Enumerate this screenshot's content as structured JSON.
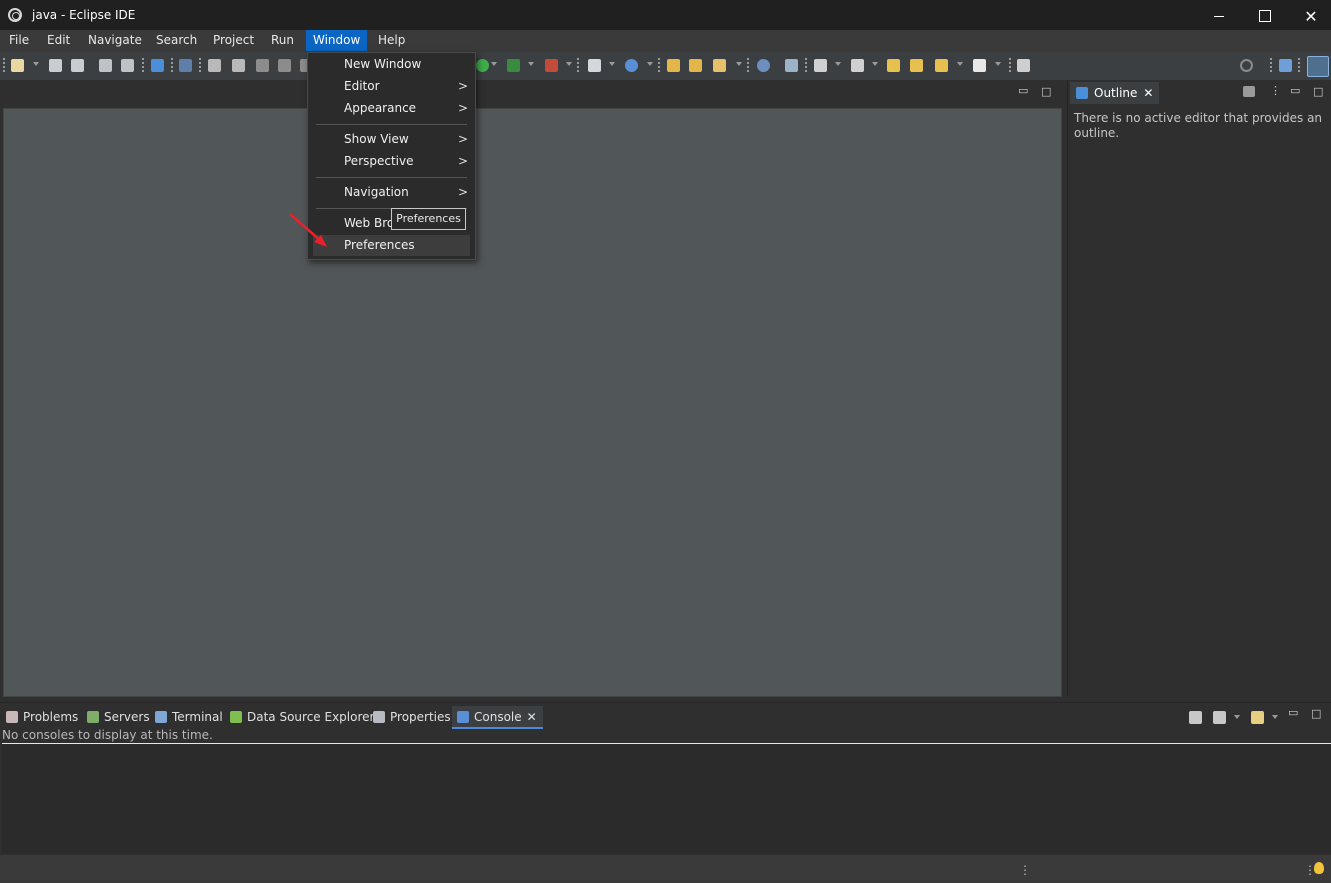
{
  "window": {
    "title": "java - Eclipse IDE",
    "minimize_icon": "minimize-icon",
    "maximize_icon": "maximize-icon",
    "close_glyph": "✕"
  },
  "menubar": {
    "items": [
      "File",
      "Edit",
      "Navigate",
      "Search",
      "Project",
      "Run",
      "Window",
      "Help"
    ],
    "active": "Window"
  },
  "window_menu": {
    "items": [
      {
        "label": "New Window",
        "submenu": false
      },
      {
        "label": "Editor",
        "submenu": true
      },
      {
        "label": "Appearance",
        "submenu": true
      },
      {
        "label": "Show View",
        "submenu": true
      },
      {
        "label": "Perspective",
        "submenu": true
      },
      {
        "label": "Navigation",
        "submenu": true
      },
      {
        "label": "Web Bro",
        "submenu": false
      },
      {
        "label": "Preferences",
        "submenu": false
      }
    ],
    "chevron": ">",
    "hovered": "Preferences"
  },
  "tooltip": {
    "text": "Preferences"
  },
  "outline": {
    "tab_label": "Outline",
    "close_glyph": "✕",
    "message": "There is no active editor that provides an outline."
  },
  "bottom_panel": {
    "tabs": [
      {
        "label": "Problems",
        "icon": "problems-icon"
      },
      {
        "label": "Servers",
        "icon": "servers-icon"
      },
      {
        "label": "Terminal",
        "icon": "terminal-icon"
      },
      {
        "label": "Data Source Explorer",
        "icon": "data-source-icon"
      },
      {
        "label": "Properties",
        "icon": "properties-icon"
      },
      {
        "label": "Console",
        "icon": "console-icon"
      }
    ],
    "active": "Console",
    "close_glyph": "✕",
    "console_message": "No consoles to display at this time."
  },
  "colors": {
    "menu_active": "#0b66c3",
    "editor_bg": "#515658",
    "annotation_arrow": "#e8202a"
  }
}
